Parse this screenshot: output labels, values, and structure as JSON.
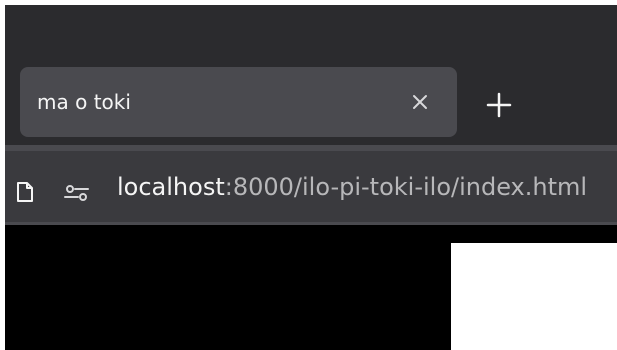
{
  "tab": {
    "title": "ma o toki",
    "close_icon": "close-icon"
  },
  "new_tab_icon": "plus-icon",
  "address_bar": {
    "page_icon": "page-icon",
    "permissions_icon": "permissions-icon",
    "host": "localhost",
    "rest": ":8000/ilo-pi-toki-ilo/index.html"
  },
  "colors": {
    "titlebar": "#2b2b2e",
    "tab": "#4a4a4f",
    "toolbar": "#3a3a3e",
    "content": "#000000",
    "panel": "#ffffff"
  }
}
